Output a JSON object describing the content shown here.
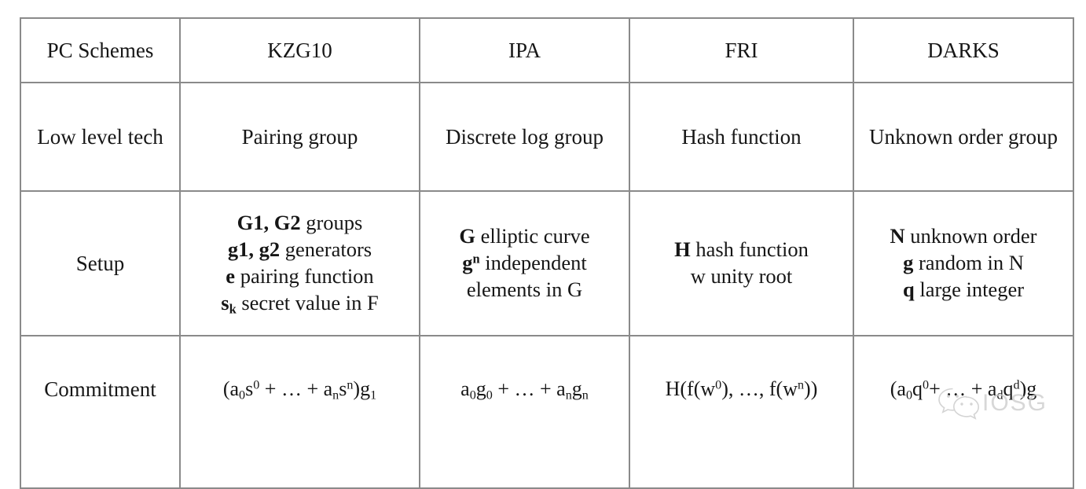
{
  "table": {
    "columns": [
      "PC Schemes",
      "KZG10",
      "IPA",
      "FRI",
      "DARKS"
    ],
    "rows": [
      {
        "label": "Low level tech",
        "cells": [
          {
            "text": "Pairing group"
          },
          {
            "text": "Discrete log group"
          },
          {
            "text": "Hash function"
          },
          {
            "text": "Unknown order group"
          }
        ]
      },
      {
        "label": "Setup",
        "cells": [
          {
            "lines": [
              {
                "sym": "G1, G2",
                "rest": " groups"
              },
              {
                "sym": "g1, g2",
                "rest": " generators"
              },
              {
                "sym": "e",
                "rest": " pairing function"
              },
              {
                "sym": "s",
                "sym_sub": "k",
                "rest": " secret value in F"
              }
            ]
          },
          {
            "lines": [
              {
                "sym": "G",
                "rest": " elliptic curve"
              },
              {
                "sym": "g",
                "sym_sup": "n",
                "rest": " independent"
              },
              {
                "sym": "",
                "rest": "elements in G"
              }
            ]
          },
          {
            "lines": [
              {
                "sym": "H",
                "rest": " hash function"
              },
              {
                "sym": "",
                "rest": "w unity root"
              }
            ]
          },
          {
            "lines": [
              {
                "sym": "N",
                "rest": " unknown order"
              },
              {
                "sym": "g",
                "rest": " random in N"
              },
              {
                "sym": "q",
                "rest": " large integer"
              }
            ]
          }
        ]
      },
      {
        "label": "Commitment",
        "cells": [
          {
            "formula": "(a0s0 + … + ansn)g1"
          },
          {
            "formula": "a0g0 + … + angn"
          },
          {
            "formula": "H(f(w0), …, f(wn))"
          },
          {
            "formula": "(a0q0+ … + adqd)g"
          }
        ]
      }
    ]
  },
  "watermark": {
    "label": "IOSG",
    "icon": "wechat-logo-icon",
    "color": "#c9c9c9"
  }
}
